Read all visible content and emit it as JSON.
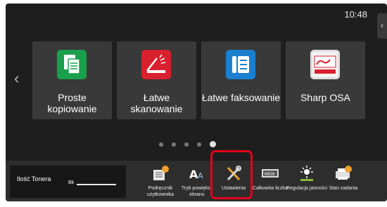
{
  "status": {
    "time": "10:48"
  },
  "side_tab_glyph": "‹",
  "nav": {
    "prev_glyph": "‹"
  },
  "apps": [
    {
      "label": "Proste kopiowanie",
      "icon": "copy-icon",
      "color": "#1a9f4c"
    },
    {
      "label": "Łatwe skanowanie",
      "icon": "scan-icon",
      "color": "#d9202e"
    },
    {
      "label": "Łatwe faksowanie",
      "icon": "fax-icon",
      "color": "#1b7fd0"
    },
    {
      "label": "Sharp OSA",
      "icon": "osa-icon",
      "color": "#e8e8e8"
    }
  ],
  "pagination": {
    "pages": 5,
    "active": 5
  },
  "toner": {
    "label": "Ilość Tonera",
    "color_code": "Bk"
  },
  "bottom_buttons": [
    {
      "label": "Podręcznik użytkownika",
      "icon": "manual-icon"
    },
    {
      "label": "Tryb powiększ ekranu",
      "icon": "text-zoom-icon"
    },
    {
      "label": "Ustawienia",
      "icon": "settings-icon"
    },
    {
      "label": "Całkowita liczba",
      "icon": "counter-icon"
    },
    {
      "label": "Regulacja jasności",
      "icon": "brightness-icon"
    },
    {
      "label": "Stan zadania",
      "icon": "job-status-icon"
    }
  ],
  "accent_colors": {
    "highlight": "#e2001a",
    "badge": "#f0a030"
  }
}
